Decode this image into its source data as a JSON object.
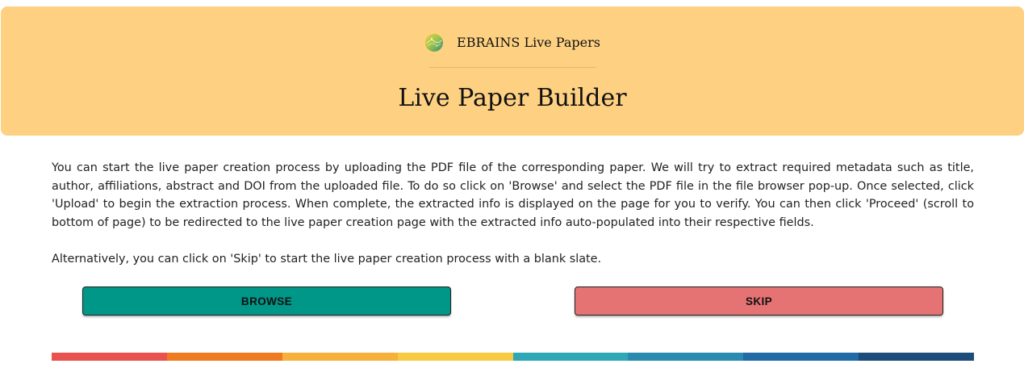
{
  "header": {
    "brand_name": "EBRAINS Live Papers",
    "title": "Live Paper Builder",
    "background": "#fed182"
  },
  "intro": {
    "paragraph1": "You can start the live paper creation process by uploading the PDF file of the corresponding paper. We will try to extract required metadata such as title, author, affiliations, abstract and DOI from the uploaded file. To do so click on 'Browse' and select the PDF file in the file browser pop-up. Once selected, click 'Upload' to begin the extraction process. When complete, the extracted info is displayed on the page for you to verify. You can then click 'Proceed' (scroll to bottom of page) to be redirected to the live paper creation page with the extracted info auto-populated into their respective fields.",
    "paragraph2": "Alternatively, you can click on 'Skip' to start the live paper creation process with a blank slate."
  },
  "buttons": {
    "browse_label": "BROWSE",
    "browse_color": "#009688",
    "skip_label": "SKIP",
    "skip_color": "#e57373"
  },
  "color_bar": [
    "#e8534f",
    "#ee7b1f",
    "#f6b13c",
    "#f8ca42",
    "#2ea8b7",
    "#2a8bb1",
    "#1f6aa7",
    "#1c4c79"
  ],
  "icons": {
    "logo": "ebrains-logo-icon"
  }
}
